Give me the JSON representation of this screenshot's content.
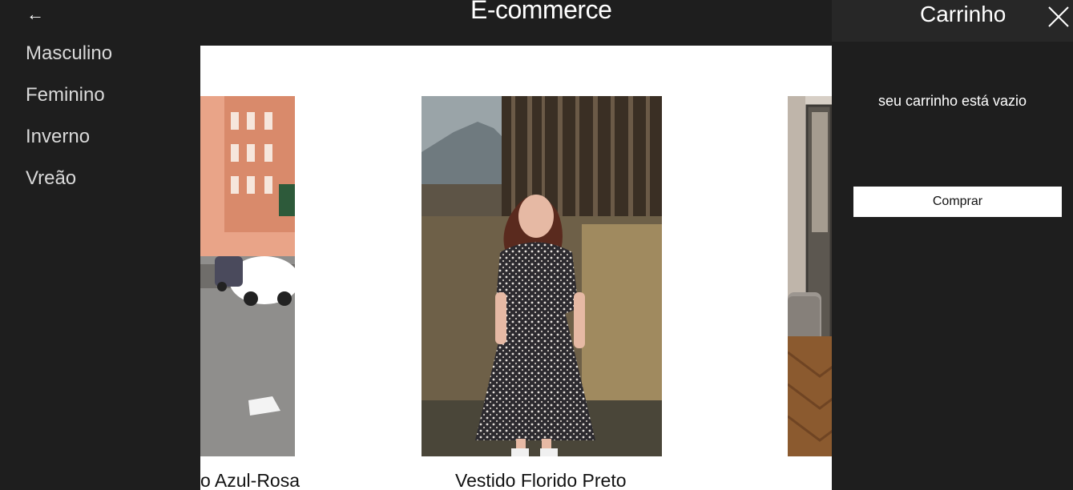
{
  "header": {
    "title": "E-commerce"
  },
  "sidebar": {
    "back_icon": "←",
    "items": [
      {
        "label": "Masculino"
      },
      {
        "label": "Feminino"
      },
      {
        "label": "Inverno"
      },
      {
        "label": "Vreão"
      }
    ]
  },
  "products": [
    {
      "name": "o Azul-Rosa",
      "image": "street-photo"
    },
    {
      "name": "Vestido Florido Preto",
      "image": "woman-floral-dress-photo"
    },
    {
      "name": "",
      "image": "interior-photo"
    }
  ],
  "cart": {
    "title": "Carrinho",
    "close_icon": "close-icon",
    "empty_message": "seu carrinho está vazio",
    "buy_label": "Comprar"
  }
}
